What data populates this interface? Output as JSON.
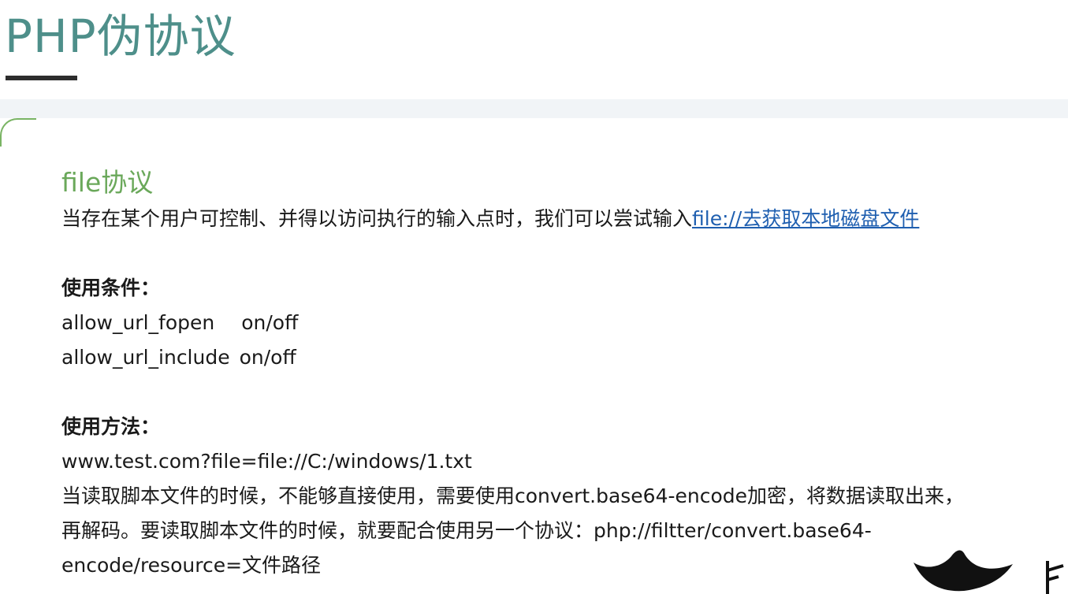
{
  "title": "PHP伪协议",
  "section": {
    "heading": "file协议",
    "intro_text": "当存在某个用户可控制、并得以访问执行的输入点时，我们可以尝试输入",
    "intro_link": "file://去获取本地磁盘文件"
  },
  "conditions": {
    "heading": "使用条件：",
    "items": [
      {
        "name": "allow_url_fopen",
        "value": "on/off"
      },
      {
        "name": "allow_url_include",
        "value": "on/off"
      }
    ]
  },
  "usage": {
    "heading": "使用方法：",
    "example": "www.test.com?file=file://C:/windows/1.txt",
    "lines": [
      "当读取脚本文件的时候，不能够直接使用，需要使用convert.base64-encode加密，将数据读取出来，",
      "再解码。要读取脚本文件的时候，就要配合使用另一个协议：php://filtter/convert.base64-",
      "encode/resource=文件路径"
    ]
  },
  "watermark": {
    "logo": "crown-logo-icon",
    "text": "卡"
  }
}
